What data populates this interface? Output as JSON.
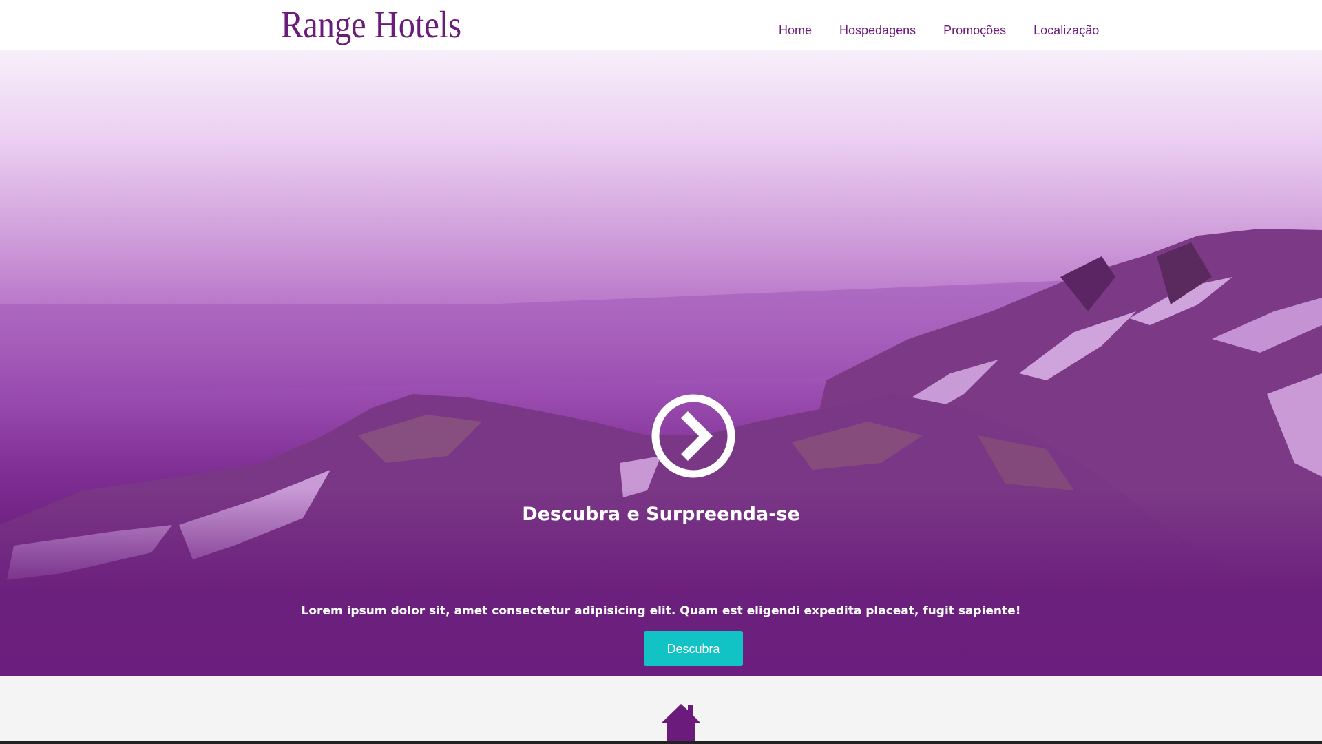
{
  "header": {
    "logo": "Range Hotels",
    "nav": [
      "Home",
      "Hospedagens",
      "Promoções",
      "Localização"
    ]
  },
  "hero": {
    "title": "Descubra e Surpreenda-se",
    "text": "Lorem ipsum dolor sit, amet consectetur adipisicing elit. Quam est eligendi expedita placeat, fugit sapiente!",
    "button_label": "Descubra",
    "arrow_icon": "chevron-right-circle-icon",
    "background_image": "purple-tinted mountain landscape"
  },
  "section2": {
    "icon": "home-icon"
  },
  "colors": {
    "brand_purple": "#6a1b7c",
    "cta_teal": "#12c3c6",
    "white": "#ffffff",
    "section_bg": "#f4f4f4"
  }
}
